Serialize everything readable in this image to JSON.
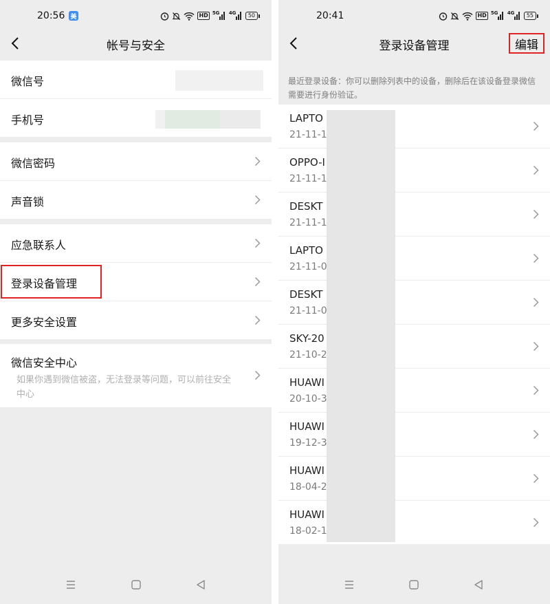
{
  "left": {
    "time": "20:56",
    "status_app_icon": "美",
    "battery": "50",
    "title": "帐号与安全",
    "group1": [
      {
        "label": "微信号",
        "value_masked": true
      },
      {
        "label": "手机号",
        "value_masked": true
      }
    ],
    "group2": [
      {
        "label": "微信密码"
      },
      {
        "label": "声音锁"
      }
    ],
    "group3": [
      {
        "label": "应急联系人"
      },
      {
        "label": "登录设备管理",
        "highlighted": true
      },
      {
        "label": "更多安全设置"
      }
    ],
    "group4": {
      "label": "微信安全中心",
      "desc": "如果你遇到微信被盗，无法登录等问题，可以前往安全中心"
    }
  },
  "right": {
    "time": "20:41",
    "battery": "55",
    "title": "登录设备管理",
    "edit_label": "编辑",
    "hint": "最近登录设备：你可以删除列表中的设备，删除后在该设备登录微信需要进行身份验证。",
    "devices": [
      {
        "name": "LAPTO",
        "date": "21-11-1"
      },
      {
        "name": "OPPO-I",
        "date": "21-11-1"
      },
      {
        "name": "DESKT",
        "date": "21-11-1"
      },
      {
        "name": "LAPTO",
        "date": "21-11-0"
      },
      {
        "name": "DESKT",
        "date": "21-11-0"
      },
      {
        "name": "SKY-20",
        "date": "21-10-2"
      },
      {
        "name": "HUAWI",
        "date": "20-10-3"
      },
      {
        "name": "HUAWI",
        "date": "19-12-3"
      },
      {
        "name": "HUAWI",
        "date": "18-04-2"
      },
      {
        "name": "HUAWI",
        "date": "18-02-1"
      }
    ]
  },
  "status": {
    "hd": "HD",
    "sig1": "5G",
    "sig2": "4G"
  },
  "icons": {
    "back": "chevron-left-icon",
    "row": "chevron-right-icon",
    "alarm": "alarm-icon",
    "mute": "bell-off-icon",
    "wifi": "wifi-icon",
    "nav_menu": "menu-icon",
    "nav_home": "home-icon",
    "nav_back": "back-triangle-icon"
  },
  "colors": {
    "highlight_red": "#e02222",
    "page_bg": "#ededed"
  }
}
